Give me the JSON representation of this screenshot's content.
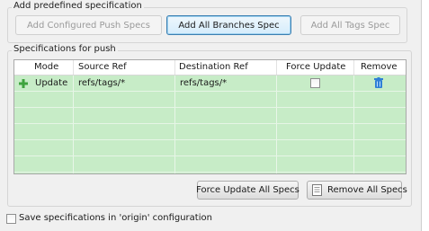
{
  "predefined": {
    "title": "Add predefined specification",
    "buttons": {
      "configured_push": "Add Configured Push Specs",
      "all_branches": "Add All Branches Spec",
      "all_tags": "Add All Tags Spec"
    }
  },
  "push_specs": {
    "title": "Specifications for push",
    "columns": {
      "mode": "Mode",
      "source_ref": "Source Ref",
      "destination_ref": "Destination Ref",
      "force_update": "Force Update",
      "remove": "Remove"
    },
    "rows": [
      {
        "mode": "Update",
        "source_ref": "refs/tags/*",
        "destination_ref": "refs/tags/*",
        "force_update": false
      }
    ],
    "buttons": {
      "force_update_all": "Force Update All Specs",
      "remove_all": "Remove All Specs"
    }
  },
  "save_option": {
    "label": "Save specifications in 'origin' configuration",
    "checked": false
  },
  "colors": {
    "table_background": "#c7ecc7",
    "add_icon": "#3ea33e",
    "remove_icon": "#2f7fd6"
  },
  "icons": {
    "row_add": "plus-icon",
    "row_remove": "trash-icon",
    "remove_all_button": "remove-all-icon"
  }
}
